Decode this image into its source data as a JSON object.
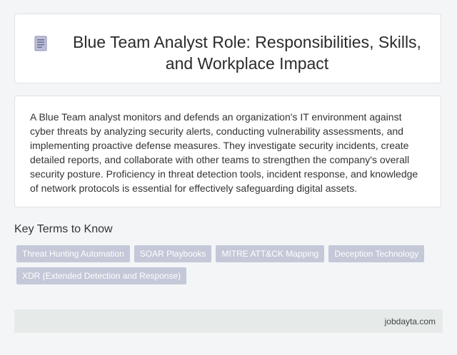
{
  "header": {
    "icon": "document-icon",
    "title": "Blue Team Analyst Role: Responsibilities, Skills, and Workplace Impact"
  },
  "summary": {
    "text": "A Blue Team analyst monitors and defends an organization's IT environment against cyber threats by analyzing security alerts, conducting vulnerability assessments, and implementing proactive defense measures. They investigate security incidents, create detailed reports, and collaborate with other teams to strengthen the company's overall security posture. Proficiency in threat detection tools, incident response, and knowledge of network protocols is essential for effectively safeguarding digital assets."
  },
  "key_terms": {
    "heading": "Key Terms to Know",
    "items": [
      {
        "label": "Threat Hunting Automation"
      },
      {
        "label": "SOAR Playbooks"
      },
      {
        "label": "MITRE ATT&CK Mapping"
      },
      {
        "label": "Deception Technology"
      },
      {
        "label": "XDR (Extended Detection and Response)"
      }
    ]
  },
  "footer": {
    "site": "jobdayta.com"
  },
  "colors": {
    "chip_bg": "#c4c8d8",
    "footer_bg": "#e6ebea",
    "icon_fill": "#bdbfd8"
  }
}
